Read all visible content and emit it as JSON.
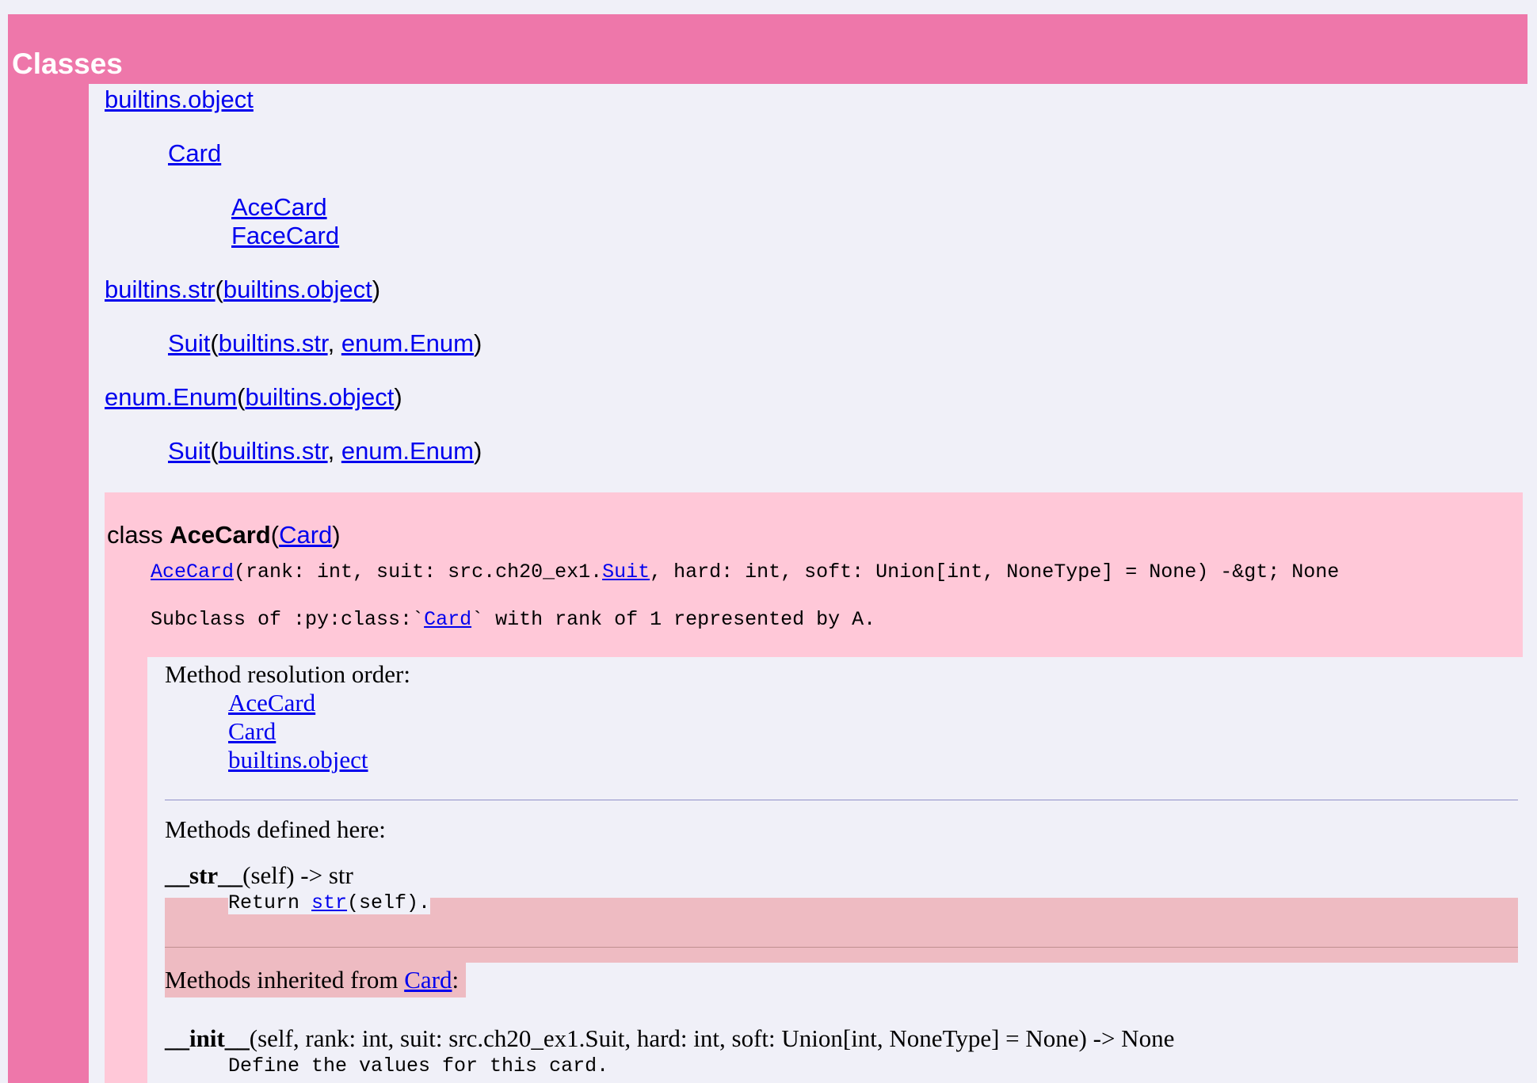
{
  "section": {
    "title": "Classes"
  },
  "tree": {
    "row1": {
      "link": "builtins.object"
    },
    "row2": {
      "link": "Card"
    },
    "row3": {
      "link": "AceCard"
    },
    "row4": {
      "link": "FaceCard"
    },
    "row5": {
      "link": "builtins.str",
      "open": "(",
      "base": "builtins.object",
      "close": ")"
    },
    "row6": {
      "link": "Suit",
      "open": "(",
      "base1": "builtins.str",
      "sep": ", ",
      "base2": "enum.Enum",
      "close": ")"
    },
    "row7": {
      "link": "enum.Enum",
      "open": "(",
      "base": "builtins.object",
      "close": ")"
    },
    "row8": {
      "link": "Suit",
      "open": "(",
      "base1": "builtins.str",
      "sep": ", ",
      "base2": "enum.Enum",
      "close": ")"
    }
  },
  "class_block": {
    "keyword": "class ",
    "name": "AceCard",
    "open": "(",
    "base": "Card",
    "close": ")",
    "signature": {
      "name_link": "AceCard",
      "part1": "(rank: int, suit: src.ch20_ex1.",
      "suit_link": "Suit",
      "part2": ", hard: int, soft: Union[int, NoneType] = None) -&gt; None"
    },
    "docstring": {
      "part1": "Subclass of :py:class:`",
      "card_link": "Card",
      "part2": "` with rank of 1 represented by A."
    }
  },
  "class_body": {
    "mro_label": "Method resolution order:",
    "mro": [
      "AceCard",
      "Card",
      "builtins.object"
    ],
    "methods_label": "Methods defined here:",
    "str_method": {
      "name": "__str__",
      "args": "(self) -> str",
      "doc_prefix": "Return ",
      "doc_link": "str",
      "doc_suffix": "(self)."
    },
    "inherited": {
      "label": "Methods inherited from ",
      "link": "Card",
      "colon": ":"
    },
    "init_method": {
      "name": "__init__",
      "args": "(self, rank: int, suit: src.ch20_ex1.Suit, hard: int, soft: Union[int, NoneType] = None) -> None",
      "doc": "Define the values for this card."
    }
  }
}
